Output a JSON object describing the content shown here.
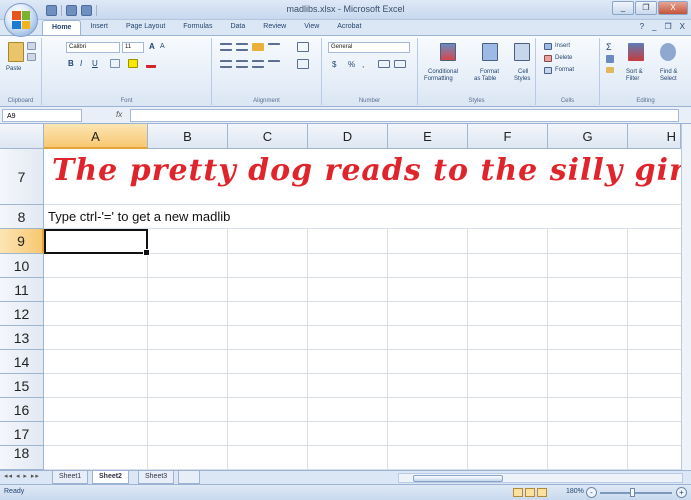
{
  "window": {
    "title": "madlibs.xlsx - Microsoft Excel",
    "controls": [
      "_",
      "❐",
      "X"
    ]
  },
  "ribbon_tabs": [
    {
      "label": "Home",
      "active": true
    },
    {
      "label": "Insert"
    },
    {
      "label": "Page Layout"
    },
    {
      "label": "Formulas"
    },
    {
      "label": "Data"
    },
    {
      "label": "Review"
    },
    {
      "label": "View"
    },
    {
      "label": "Acrobat"
    }
  ],
  "ribbon_right": [
    "?",
    "_",
    "❐",
    "X"
  ],
  "ribbon": {
    "clipboard": {
      "paste": "Paste",
      "label": "Clipboard"
    },
    "font": {
      "name": "Calibri",
      "size": "11",
      "bold": "B",
      "italic": "I",
      "underline": "U",
      "grow": "A",
      "shrink": "A",
      "label": "Font"
    },
    "alignment": {
      "label": "Alignment"
    },
    "number": {
      "format": "General",
      "currency": "$",
      "percent": "%",
      "comma": ",",
      "label": "Number"
    },
    "styles": {
      "conditional": "Conditional",
      "conditional2": "Formatting",
      "format_table": "Format",
      "format_table2": "as Table",
      "cell_styles": "Cell",
      "cell_styles2": "Styles",
      "label": "Styles"
    },
    "cells": {
      "insert": "Insert",
      "delete": "Delete",
      "format": "Format",
      "label": "Cells"
    },
    "editing": {
      "sigma": "Σ",
      "sort": "Sort &",
      "sort2": "Filter",
      "find": "Find &",
      "find2": "Select",
      "label": "Editing"
    }
  },
  "formula_bar": {
    "name_box": "A9",
    "fx": "fx",
    "content": ""
  },
  "columns": [
    "A",
    "B",
    "C",
    "D",
    "E",
    "F",
    "G",
    "H"
  ],
  "rows": [
    "7",
    "8",
    "9",
    "10",
    "11",
    "12",
    "13",
    "14",
    "15",
    "16",
    "17",
    "18"
  ],
  "selected": {
    "column": "A",
    "row": "9"
  },
  "cells": {
    "a7": "The pretty dog reads to the silly girl",
    "a8": "Type ctrl-'=' to get a new madlib"
  },
  "sheets": [
    {
      "name": "Sheet1"
    },
    {
      "name": "Sheet2",
      "active": true
    },
    {
      "name": "Sheet3"
    }
  ],
  "status": {
    "text": "Ready",
    "zoom": "180%",
    "zoom_minus": "-",
    "zoom_plus": "+"
  },
  "colors": {
    "title_text": "#e0242b",
    "accent_header": "#f8c872"
  }
}
